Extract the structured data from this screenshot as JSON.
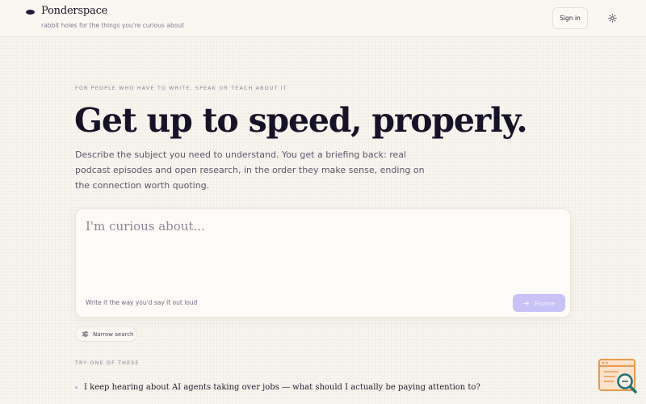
{
  "brand": {
    "name": "Ponderspace",
    "tagline": "rabbit holes for the things you're curious about"
  },
  "header": {
    "sign_in_label": "Sign in",
    "theme_icon": "sun-icon"
  },
  "hero": {
    "eyebrow": "FOR PEOPLE WHO HAVE TO WRITE, SPEAK OR TEACH ABOUT IT",
    "headline": "Get up to speed, properly.",
    "subcopy": "Describe the subject you need to understand. You get a briefing back: real podcast episodes and open research, in the order they make sense, ending on the connection worth quoting."
  },
  "search": {
    "placeholder": "I'm curious about...",
    "value": "",
    "hint": "Write it the way you'd say it out loud",
    "explore_label": "Explore",
    "explore_icon": "arrow-right-icon"
  },
  "filters": {
    "narrow_label": "Narrow search",
    "narrow_icon": "sliders-icon"
  },
  "suggestions": {
    "label": "TRY ONE OF THESE",
    "items": [
      "I keep hearing about AI agents taking over jobs — what should I actually be paying attention to?"
    ]
  },
  "colors": {
    "background": "#f8f5ef",
    "ink": "#161328",
    "accent": "#c9c2f6",
    "widget_orange": "#e99a4f",
    "widget_teal": "#1f6f7a"
  }
}
